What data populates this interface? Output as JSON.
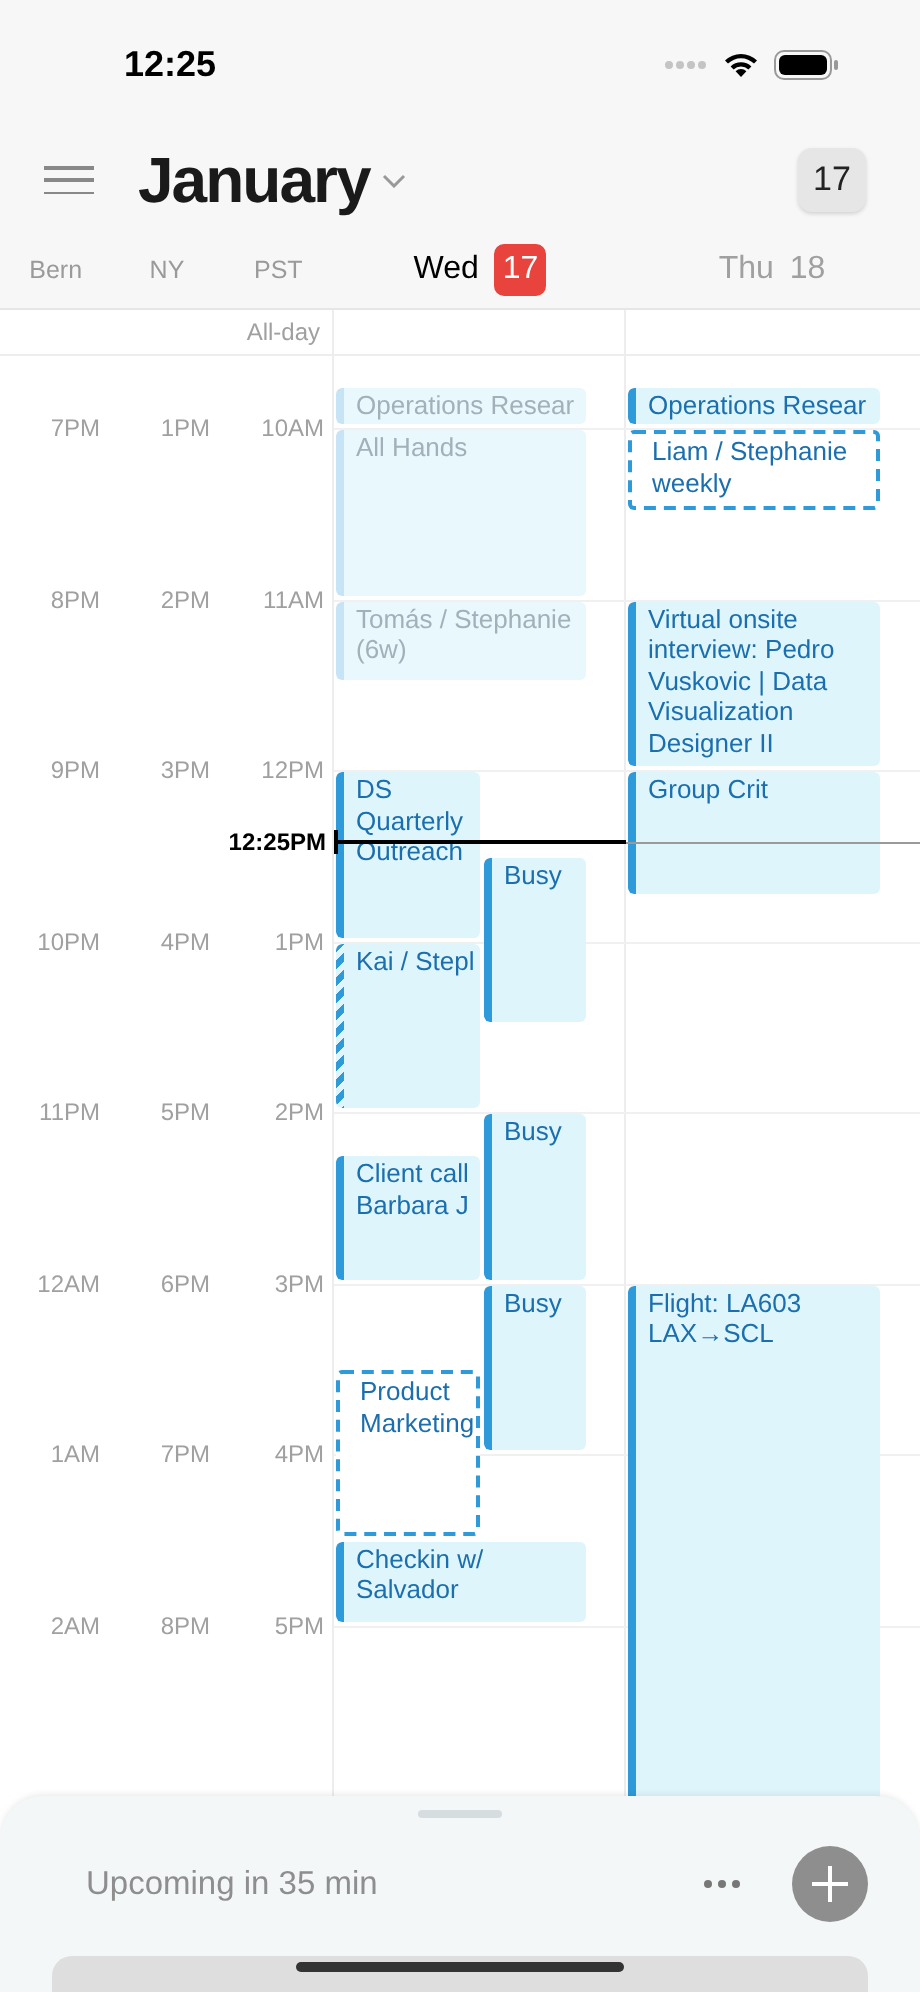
{
  "status_bar": {
    "time": "12:25"
  },
  "header": {
    "month": "January",
    "today_button": "17"
  },
  "timezones": [
    {
      "label": "Bern"
    },
    {
      "label": "NY"
    },
    {
      "label": "PST"
    }
  ],
  "all_day_label": "All-day",
  "hours": [
    {
      "labels": [
        "7PM",
        "1PM",
        "10AM"
      ]
    },
    {
      "labels": [
        "8PM",
        "2PM",
        "11AM"
      ]
    },
    {
      "labels": [
        "9PM",
        "3PM",
        "12PM"
      ]
    },
    {
      "labels": [
        "10PM",
        "4PM",
        "1PM"
      ]
    },
    {
      "labels": [
        "11PM",
        "5PM",
        "2PM"
      ]
    },
    {
      "labels": [
        "12AM",
        "6PM",
        "3PM"
      ]
    },
    {
      "labels": [
        "1AM",
        "7PM",
        "4PM"
      ]
    },
    {
      "labels": [
        "2AM",
        "8PM",
        "5PM"
      ]
    }
  ],
  "now": {
    "label": "12:25PM"
  },
  "days": [
    {
      "weekday": "Wed",
      "date": "17",
      "today": true,
      "events": [
        {
          "title": "Operations Resear",
          "kind": "solid",
          "faded": true
        },
        {
          "title": "All Hands",
          "kind": "solid",
          "faded": true
        },
        {
          "title": "Tomás / Stephanie (6w)",
          "kind": "solid",
          "faded": true
        },
        {
          "title": "DS Quarterly Outreach",
          "kind": "solid",
          "faded": false
        },
        {
          "title": "Kai / Stepl",
          "kind": "striped",
          "faded": false
        },
        {
          "title": "Busy",
          "kind": "solid",
          "faded": false
        },
        {
          "title": "Client call Barbara J",
          "kind": "solid",
          "faded": false
        },
        {
          "title": "Busy",
          "kind": "solid",
          "faded": false
        },
        {
          "title": "Product Marketing",
          "kind": "dashed",
          "faded": false
        },
        {
          "title": "Busy",
          "kind": "solid",
          "faded": false
        },
        {
          "title": "Checkin w/ Salvador",
          "kind": "solid",
          "faded": false
        }
      ]
    },
    {
      "weekday": "Thu",
      "date": "18",
      "today": false,
      "events": [
        {
          "title": "Operations Resear",
          "kind": "solid",
          "faded": false
        },
        {
          "title": "Liam / Stephanie weekly",
          "kind": "dashed",
          "faded": false
        },
        {
          "title": "Virtual onsite interview: Pedro Vuskovic | Data Visualization Designer II",
          "kind": "solid",
          "faded": false
        },
        {
          "title": "Group Crit",
          "kind": "solid",
          "faded": false
        },
        {
          "title": "Flight: LA603 LAX→SCL",
          "kind": "solid",
          "faded": false
        }
      ]
    }
  ],
  "bottom_sheet": {
    "upcoming": "Upcoming in 35 min"
  }
}
